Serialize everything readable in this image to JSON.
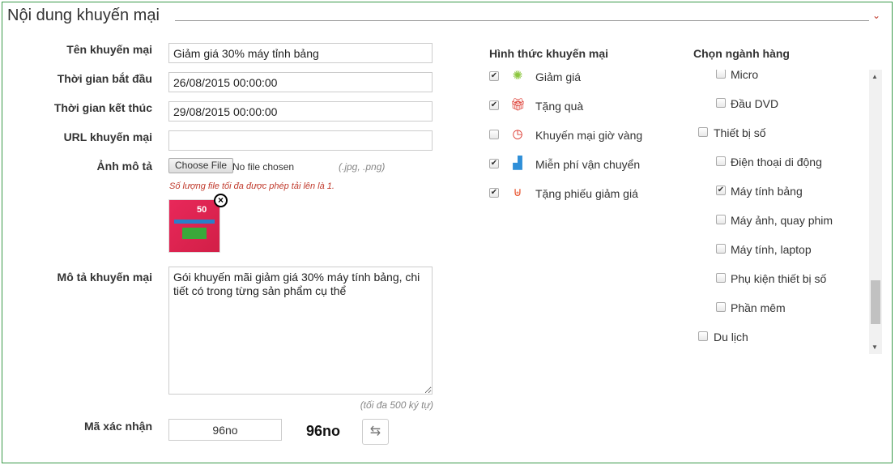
{
  "section": {
    "title": "Nội dung khuyến mại"
  },
  "form": {
    "name": {
      "label": "Tên khuyến mại",
      "value": "Giảm giá 30% máy tỉnh bảng"
    },
    "start": {
      "label": "Thời gian bắt đầu",
      "value": "26/08/2015 00:00:00"
    },
    "end": {
      "label": "Thời gian kết thúc",
      "value": "29/08/2015 00:00:00"
    },
    "url": {
      "label": "URL khuyến mại",
      "value": ""
    },
    "image": {
      "label": "Ảnh mô tả",
      "choose": "Choose File",
      "status": "No file chosen",
      "types": "(.jpg, .png)",
      "note": "Số lượng file tối đa được phép tải lên là 1.",
      "thumb_text": "50"
    },
    "desc": {
      "label": "Mô tả khuyến mại",
      "value": "Gói khuyến mãi giảm giá 30% máy tính bảng, chi tiết có trong từng sản phẩm cụ thể",
      "hint": "(tối đa 500 ký tự)"
    },
    "captcha": {
      "label": "Mã xác nhận",
      "value": "96no",
      "image_text": "96no"
    }
  },
  "promo_types": {
    "title": "Hình thức khuyến mại",
    "items": [
      {
        "label": "Giảm giá",
        "checked": true,
        "icon": "discount-badge-icon",
        "color": "#8cc63f"
      },
      {
        "label": "Tặng quà",
        "checked": true,
        "icon": "gift-icon",
        "color": "#d9261c"
      },
      {
        "label": "Khuyến mại giờ vàng",
        "checked": false,
        "icon": "clock-icon",
        "color": "#d9261c"
      },
      {
        "label": "Miễn phí vận chuyển",
        "checked": true,
        "icon": "truck-icon",
        "color": "#2f8fd8"
      },
      {
        "label": "Tặng phiếu giảm giá",
        "checked": true,
        "icon": "basket-icon",
        "color": "#e8542e"
      }
    ]
  },
  "categories": {
    "title": "Chọn ngành hàng",
    "items": [
      {
        "label": "Micro",
        "level": 2,
        "checked": false
      },
      {
        "label": "Đầu DVD",
        "level": 2,
        "checked": false
      },
      {
        "label": "Thiết bị số",
        "level": 1,
        "checked": false
      },
      {
        "label": "Điện thoại di động",
        "level": 2,
        "checked": false
      },
      {
        "label": "Máy tính bảng",
        "level": 2,
        "checked": true
      },
      {
        "label": "Máy ảnh, quay phim",
        "level": 2,
        "checked": false
      },
      {
        "label": "Máy tính, laptop",
        "level": 2,
        "checked": false
      },
      {
        "label": "Phụ kiện thiết bị số",
        "level": 2,
        "checked": false
      },
      {
        "label": "Phần mêm",
        "level": 2,
        "checked": false
      },
      {
        "label": "Du lịch",
        "level": 1,
        "checked": false
      }
    ]
  }
}
